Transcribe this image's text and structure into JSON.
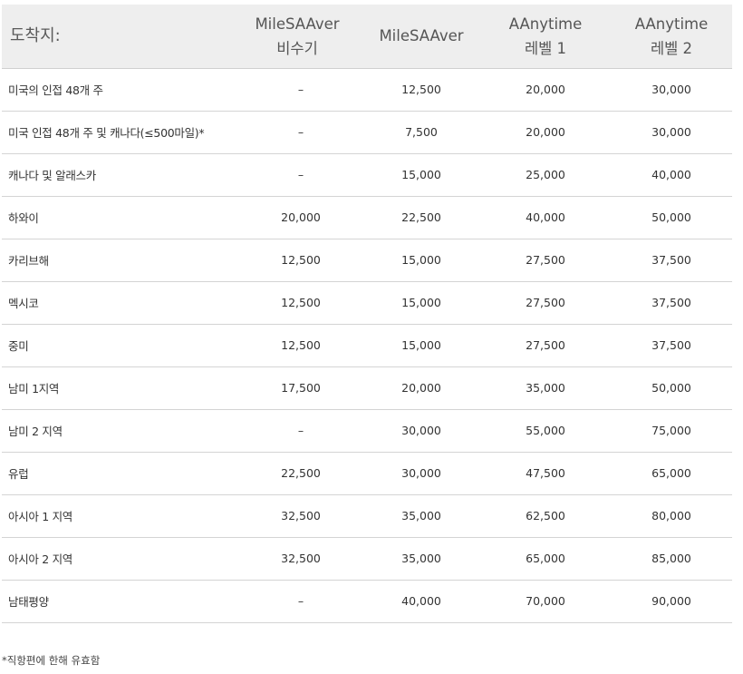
{
  "table": {
    "headers": {
      "destination": "도착지:",
      "col1": [
        "MileSAAver",
        "비수기"
      ],
      "col2": "MileSAAver",
      "col3": [
        "AAnytime",
        "레벨 1"
      ],
      "col4": [
        "AAnytime",
        "레벨 2"
      ]
    },
    "rows": [
      [
        "미국의 인접 48개 주",
        "–",
        "12,500",
        "20,000",
        "30,000"
      ],
      [
        "미국 인접 48개 주 및 캐나다(≤500마일)*",
        "–",
        "7,500",
        "20,000",
        "30,000"
      ],
      [
        "캐나다 및 알래스카",
        "–",
        "15,000",
        "25,000",
        "40,000"
      ],
      [
        "하와이",
        "20,000",
        "22,500",
        "40,000",
        "50,000"
      ],
      [
        "카리브해",
        "12,500",
        "15,000",
        "27,500",
        "37,500"
      ],
      [
        "멕시코",
        "12,500",
        "15,000",
        "27,500",
        "37,500"
      ],
      [
        "중미",
        "12,500",
        "15,000",
        "27,500",
        "37,500"
      ],
      [
        "남미 1지역",
        "17,500",
        "20,000",
        "35,000",
        "50,000"
      ],
      [
        "남미 2 지역",
        "–",
        "30,000",
        "55,000",
        "75,000"
      ],
      [
        "유럽",
        "22,500",
        "30,000",
        "47,500",
        "65,000"
      ],
      [
        "아시아 1 지역",
        "32,500",
        "35,000",
        "62,500",
        "80,000"
      ],
      [
        "아시아 2 지역",
        "32,500",
        "35,000",
        "65,000",
        "85,000"
      ],
      [
        "남태평양",
        "–",
        "40,000",
        "70,000",
        "90,000"
      ]
    ]
  },
  "footnote": "*직항편에 한해 유효함"
}
